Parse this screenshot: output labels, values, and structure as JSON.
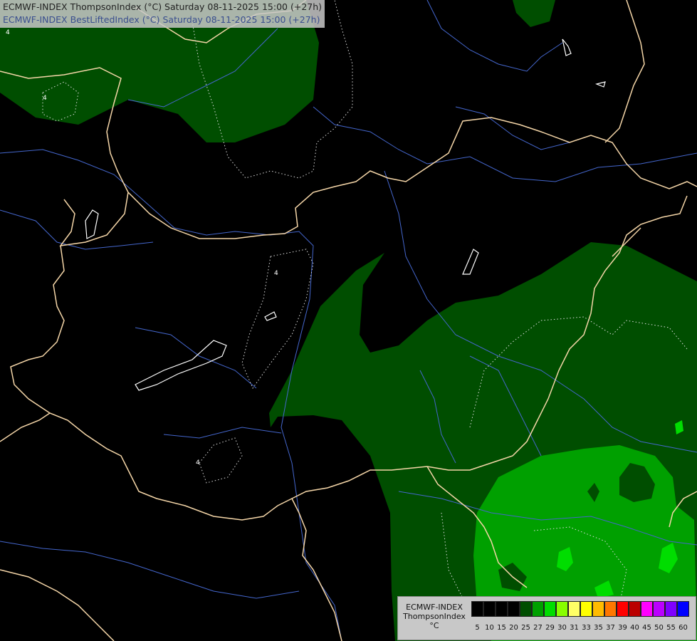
{
  "titles": {
    "line1": "ECMWF-INDEX ThompsonIndex (°C) Saturday 08-11-2025 15:00 (+27h)",
    "line2": "ECMWF-INDEX BestLiftedIndex (°C) Saturday 08-11-2025 15:00 (+27h)"
  },
  "legend": {
    "model": "ECMWF-INDEX",
    "parameter": "ThompsonIndex",
    "unit": "°C",
    "levels": [
      "5",
      "10",
      "15",
      "20",
      "25",
      "27",
      "29",
      "30",
      "31",
      "33",
      "35",
      "37",
      "39",
      "40",
      "45",
      "50",
      "55",
      "60"
    ],
    "colors": [
      "#000000",
      "#000000",
      "#000000",
      "#000000",
      "#004e00",
      "#00a000",
      "#00dd00",
      "#88ff00",
      "#ffff66",
      "#ffff00",
      "#ffbb00",
      "#ff7700",
      "#ff0000",
      "#bb0000",
      "#ff00ff",
      "#bb00ff",
      "#7f00ff",
      "#0000ff"
    ]
  },
  "contour_labels": [
    "4",
    "4",
    "4",
    "4"
  ],
  "colors": {
    "dark_green": "#004e00",
    "mid_green": "#00a000",
    "bright_green": "#00dd00",
    "border": "#f5d6a8",
    "river": "#4466cc"
  }
}
